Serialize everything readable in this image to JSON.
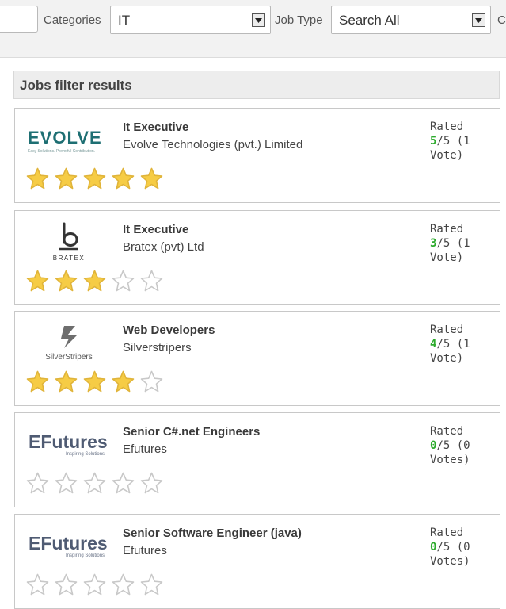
{
  "filters": {
    "categories_label": "Categories",
    "categories_value": "IT",
    "job_type_label": "Job Type",
    "job_type_value": "Search All",
    "next_label_partial": "C"
  },
  "results": {
    "title": "Jobs filter results"
  },
  "jobs": [
    {
      "title": "It Executive",
      "company": "Evolve Technologies (pvt.) Limited",
      "rated_label": "Rated",
      "score": "5",
      "out_of": "/5 (1",
      "votes": "Vote)",
      "stars": 5,
      "logo": {
        "name": "evolve-logo",
        "wordmark": "EVOLVE",
        "tagline": "Easy Solutions. Powerful Contribution."
      }
    },
    {
      "title": "It Executive",
      "company": "Bratex (pvt) Ltd",
      "rated_label": "Rated",
      "score": "3",
      "out_of": "/5 (1",
      "votes": "Vote)",
      "stars": 3,
      "logo": {
        "name": "bratex-logo",
        "wordmark": "BRATEX",
        "tagline": ""
      }
    },
    {
      "title": "Web Developers",
      "company": "Silverstripers",
      "rated_label": "Rated",
      "score": "4",
      "out_of": "/5 (1",
      "votes": "Vote)",
      "stars": 4,
      "logo": {
        "name": "silverstripers-logo",
        "wordmark": "SilverStripers",
        "tagline": ""
      }
    },
    {
      "title": "Senior C#.net Engineers",
      "company": "Efutures",
      "rated_label": "Rated",
      "score": "0",
      "out_of": "/5 (0",
      "votes": "Votes)",
      "stars": 0,
      "logo": {
        "name": "efutures-logo",
        "wordmark": "EFutures",
        "tagline": "Inspiring Solutions"
      }
    },
    {
      "title": "Senior Software Engineer (java)",
      "company": "Efutures",
      "rated_label": "Rated",
      "score": "0",
      "out_of": "/5 (0",
      "votes": "Votes)",
      "stars": 0,
      "logo": {
        "name": "efutures-logo",
        "wordmark": "EFutures",
        "tagline": "Inspiring Solutions"
      }
    }
  ],
  "colors": {
    "score_green": "#2eab2e",
    "star_fill": "#f6cc45",
    "star_empty_stroke": "#c8c8c8"
  }
}
